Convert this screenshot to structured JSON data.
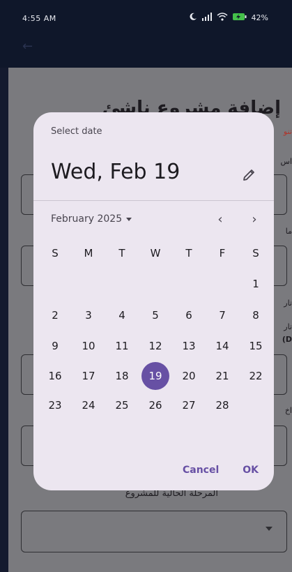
{
  "status_bar": {
    "time": "4:55 AM",
    "battery": "42%"
  },
  "form": {
    "title": "إضافة مشروع ناشئ",
    "edge_texts": [
      "تنو",
      "اس",
      "ما",
      "تار",
      "تار",
      "D)",
      "اخ"
    ],
    "phase_label": "المرحلة الحالية للمشروع"
  },
  "date_picker": {
    "label": "Select date",
    "headline": "Wed, Feb 19",
    "month_year": "February 2025",
    "weekdays": [
      "S",
      "M",
      "T",
      "W",
      "T",
      "F",
      "S"
    ],
    "weeks": [
      [
        "",
        "",
        "",
        "",
        "",
        "",
        "1"
      ],
      [
        "2",
        "3",
        "4",
        "5",
        "6",
        "7",
        "8"
      ],
      [
        "9",
        "10",
        "11",
        "12",
        "13",
        "14",
        "15"
      ],
      [
        "16",
        "17",
        "18",
        "19",
        "20",
        "21",
        "22"
      ],
      [
        "23",
        "24",
        "25",
        "26",
        "27",
        "28",
        ""
      ]
    ],
    "selected_day": "19",
    "cancel_label": "Cancel",
    "ok_label": "OK"
  },
  "colors": {
    "accent": "#6750a4",
    "dialog_bg": "#ece6f0",
    "scrim": "#7a7a7e",
    "app_bar": "#0f172a"
  },
  "icons": [
    "moon-icon",
    "signal-icon",
    "wifi-icon",
    "battery-charging-icon",
    "back-arrow-icon",
    "edit-pencil-icon",
    "chevron-left-icon",
    "chevron-right-icon",
    "dropdown-triangle-icon"
  ]
}
